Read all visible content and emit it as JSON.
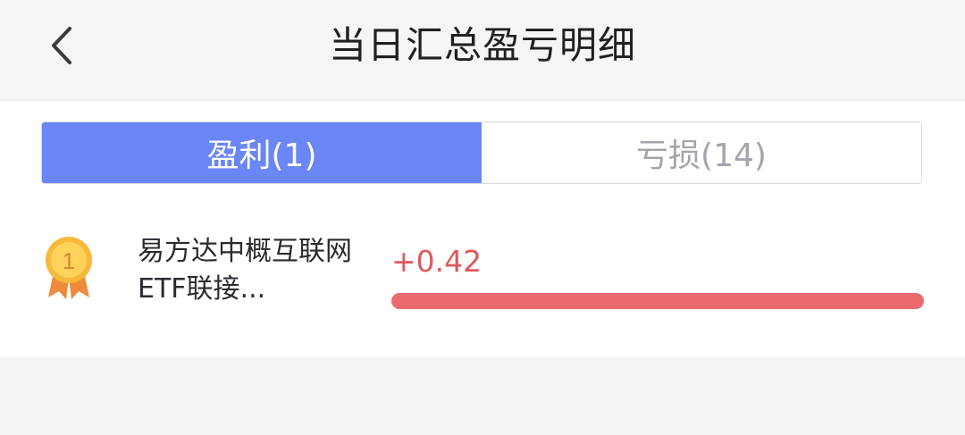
{
  "header": {
    "title": "当日汇总盈亏明细",
    "back_icon": "chevron-left-icon"
  },
  "tabs": [
    {
      "label": "盈利(1)",
      "active": true
    },
    {
      "label": "亏损(14)",
      "active": false
    }
  ],
  "colors": {
    "accent": "#6b86f6",
    "profit": "#e0585c",
    "bar": "#ea6a6e"
  },
  "profit_list": [
    {
      "rank": "1",
      "rank_icon": "gold-medal-icon",
      "name": "易方达中概互联网ETF联接...",
      "value": "+0.42",
      "bar_fraction": 1.0
    }
  ]
}
